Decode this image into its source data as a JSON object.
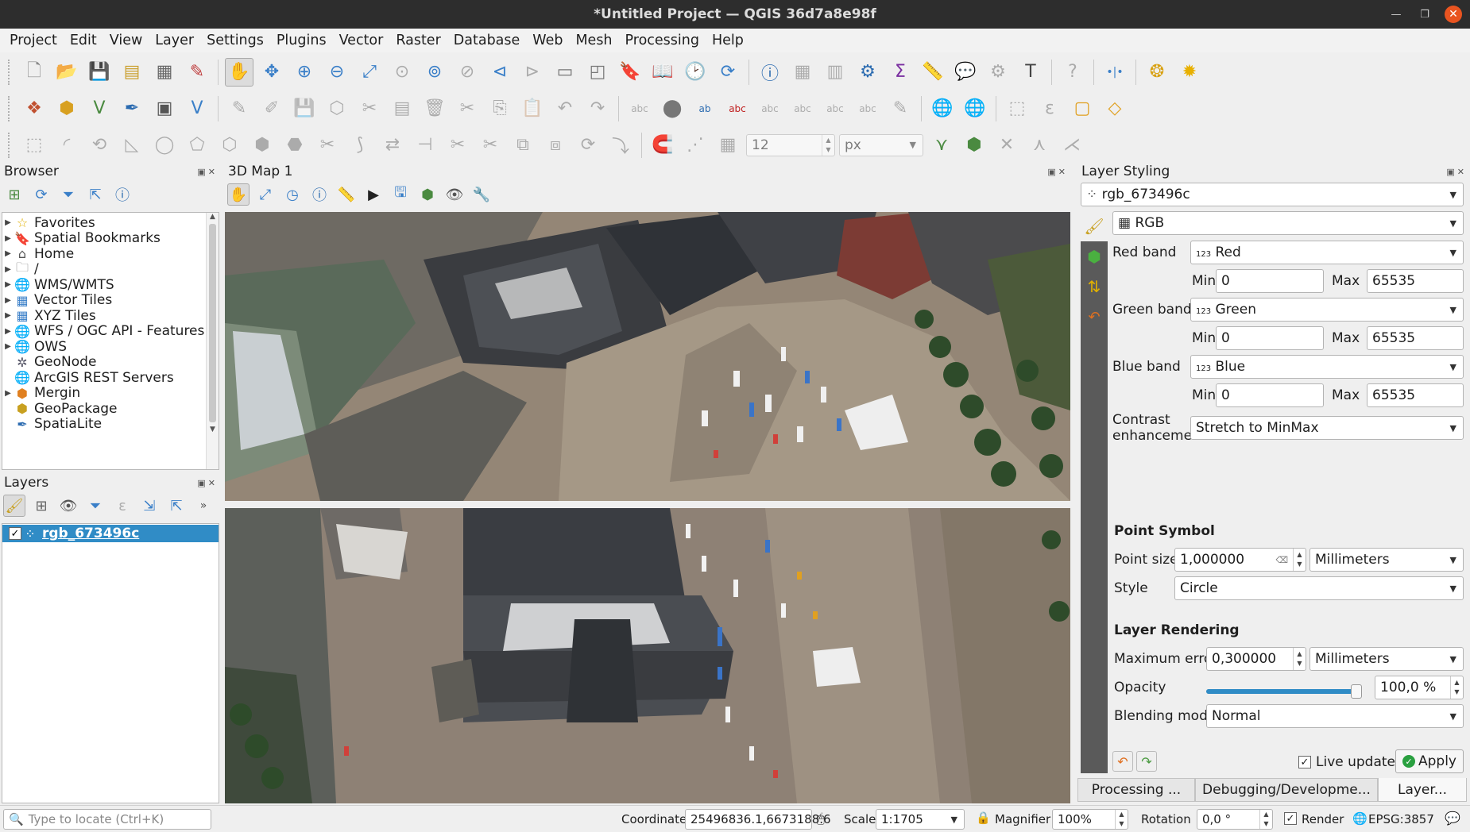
{
  "window": {
    "title": "*Untitled Project — QGIS 36d7a8e98f"
  },
  "menu": [
    "Project",
    "Edit",
    "View",
    "Layer",
    "Settings",
    "Plugins",
    "Vector",
    "Raster",
    "Database",
    "Web",
    "Mesh",
    "Processing",
    "Help"
  ],
  "toolbar3": {
    "size_value": "12",
    "size_unit": "px"
  },
  "browser": {
    "title": "Browser",
    "items": [
      {
        "label": "Favorites",
        "icon": "star-icon"
      },
      {
        "label": "Spatial Bookmarks",
        "icon": "bookmark-icon"
      },
      {
        "label": "Home",
        "icon": "home-icon"
      },
      {
        "label": "/",
        "icon": "folder-icon"
      },
      {
        "label": "WMS/WMTS",
        "icon": "globe-icon"
      },
      {
        "label": "Vector Tiles",
        "icon": "grid-icon"
      },
      {
        "label": "XYZ Tiles",
        "icon": "grid-icon"
      },
      {
        "label": "WFS / OGC API - Features",
        "icon": "globe-icon"
      },
      {
        "label": "OWS",
        "icon": "globe-icon"
      },
      {
        "label": "GeoNode",
        "icon": "geonode-icon"
      },
      {
        "label": "ArcGIS REST Servers",
        "icon": "globe-icon"
      },
      {
        "label": "Mergin",
        "icon": "mergin-icon"
      },
      {
        "label": "GeoPackage",
        "icon": "geopackage-icon"
      },
      {
        "label": "SpatiaLite",
        "icon": "feather-icon"
      }
    ]
  },
  "layers": {
    "title": "Layers",
    "items": [
      {
        "label": "rgb_673496c",
        "checked": true
      }
    ]
  },
  "map3d": {
    "title": "3D Map 1"
  },
  "styling": {
    "title": "Layer Styling",
    "layer": "rgb_673496c",
    "renderer": "RGB",
    "red_band_label": "Red band",
    "red_band": "Red",
    "green_band_label": "Green band",
    "green_band": "Green",
    "blue_band_label": "Blue band",
    "blue_band": "Blue",
    "band_prefix": "123",
    "min_label": "Min",
    "max_label": "Max",
    "red_min": "0",
    "red_max": "65535",
    "green_min": "0",
    "green_max": "65535",
    "blue_min": "0",
    "blue_max": "65535",
    "contrast_label_1": "Contrast",
    "contrast_label_2": "enhancement",
    "contrast_value": "Stretch to MinMax",
    "point_symbol_header": "Point Symbol",
    "point_size_label": "Point size",
    "point_size_value": "1,000000",
    "point_size_unit": "Millimeters",
    "style_label": "Style",
    "style_value": "Circle",
    "layer_rendering_header": "Layer Rendering",
    "max_error_label": "Maximum error",
    "max_error_value": "0,300000",
    "max_error_unit": "Millimeters",
    "opacity_label": "Opacity",
    "opacity_value": "100,0 %",
    "opacity_fraction": 1.0,
    "blending_label": "Blending mode",
    "blending_value": "Normal",
    "live_update_label": "Live update",
    "apply_label": "Apply"
  },
  "bottom_tabs": [
    "Processing ...",
    "Debugging/Developme...",
    "Layer..."
  ],
  "status": {
    "locator_placeholder": "Type to locate (Ctrl+K)",
    "coordinate_label": "Coordinate",
    "coordinate_value": "25496836.1,6673188.6",
    "scale_label": "Scale",
    "scale_value": "1:1705",
    "magnifier_label": "Magnifier",
    "magnifier_value": "100%",
    "rotation_label": "Rotation",
    "rotation_value": "0,0 °",
    "render_label": "Render",
    "crs": "EPSG:3857"
  },
  "colors": {
    "accent": "#308cc6",
    "titlebar": "#2d2d2d",
    "close": "#e95420"
  }
}
